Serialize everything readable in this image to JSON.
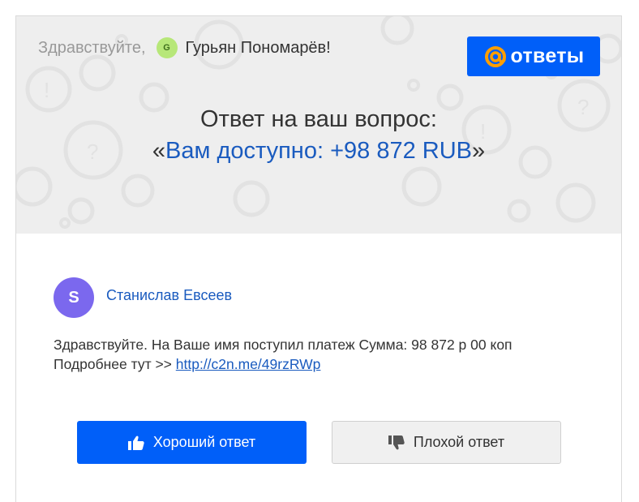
{
  "header": {
    "greeting_prefix": "Здравствуйте,",
    "user_avatar_letter": "G",
    "user_name": "Гурьян Пономарёв!",
    "logo_text": "ответы",
    "logo_icon": "at-icon",
    "title_line1": "Ответ на ваш вопрос:",
    "quote_open": "«",
    "question_text": "Вам доступно: +98 872 RUB",
    "quote_close": "»"
  },
  "answer": {
    "author_initial": "S",
    "author_name": "Станислав Евсеев",
    "text_line1": "Здравствуйте. На Ваше имя поступил платеж Сумма: 98 872 р 00 коп",
    "text_line2_prefix": "Подробнее тут >> ",
    "link": "http://c2n.me/49rzRWp"
  },
  "buttons": {
    "good_label": "Хороший ответ",
    "good_icon": "thumbs-up-icon",
    "bad_label": "Плохой ответ",
    "bad_icon": "thumbs-down-icon"
  },
  "colors": {
    "brand_blue": "#005ff9",
    "link_blue": "#1a5bbf",
    "header_bg": "#eeeeee",
    "author_avatar": "#7b68ee",
    "user_avatar": "#b7e779"
  }
}
